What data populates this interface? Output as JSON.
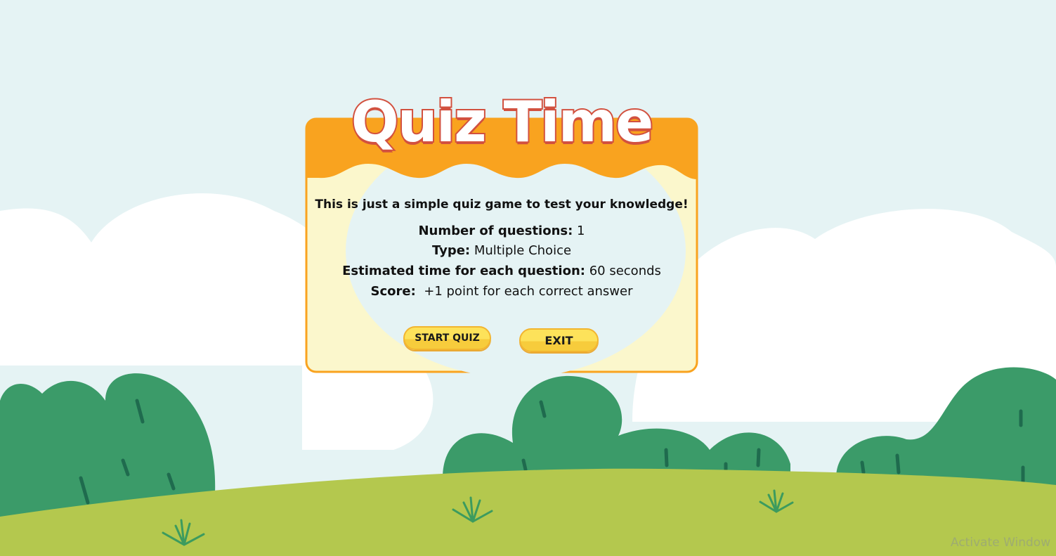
{
  "title": "Quiz Time",
  "intro": "This is just a simple quiz game to test your knowledge!",
  "info": {
    "questions_label": "Number of questions:",
    "questions_value": "1",
    "type_label": "Type:",
    "type_value": "Multiple Choice",
    "time_label": "Estimated time for each question:",
    "time_value": "60 seconds",
    "score_label": "Score:",
    "score_value": "+1 point for each correct answer"
  },
  "buttons": {
    "start": "START QUIZ",
    "exit": "EXIT"
  },
  "watermark": "Activate Window",
  "colors": {
    "sky": "#e5f3f4",
    "ground": "#b4c84e",
    "bush": "#3b9b69",
    "card_header": "#f9a31f",
    "card_body": "#fbf7cc",
    "title_stroke": "#d2513f",
    "button": "#fddc4f"
  },
  "icons": [
    "cloud-shape",
    "bush-shape",
    "grass-tuft-icon"
  ]
}
